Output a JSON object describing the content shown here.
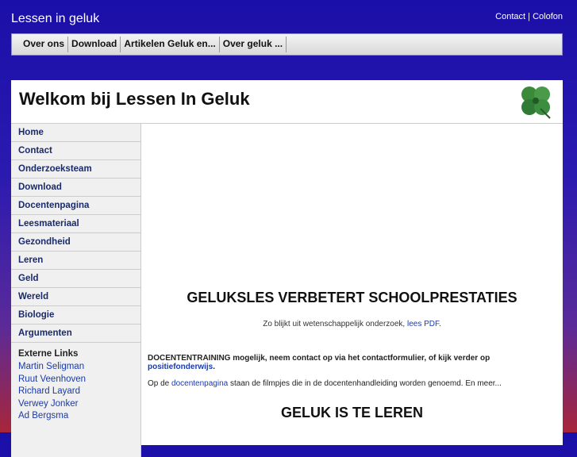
{
  "site": {
    "title": "Lessen in geluk",
    "top_links": [
      "Contact",
      "|",
      "Colofon"
    ]
  },
  "navbar": {
    "items": [
      "Over ons",
      "Download",
      "Artikelen Geluk en...",
      "Over geluk ..."
    ]
  },
  "header": {
    "title": "Welkom bij Lessen In Geluk",
    "logo_icon": "four-leaf-clover-icon"
  },
  "sidebar": {
    "items": [
      "Home",
      "Contact",
      "Onderzoeksteam",
      "Download",
      "Docentenpagina",
      "Leesmateriaal",
      "Gezondheid",
      "Leren",
      "Geld",
      "Wereld",
      "Biologie",
      "Argumenten"
    ],
    "external_title": "Externe Links",
    "external_links": [
      "Martin Seligman",
      "Ruut Veenhoven",
      "Richard Layard",
      "Verwey Jonker",
      "Ad Bergsma"
    ]
  },
  "content": {
    "heading1": "GELUKSLES VERBETERT SCHOOLPRESTATIES",
    "sub_text": "Zo blijkt uit wetenschappelijk onderzoek,",
    "sub_link": "lees PDF",
    "sub_end": ".",
    "training_text": "DOCENTENTRAINING mogelijk, neem contact op via het contactformulier, of kijk verder op",
    "training_link": "positiefonderwijs",
    "training_end": ".",
    "line_pre": "Op de",
    "line_link": "docentenpagina",
    "line_post": "staan de filmpjes die in de docentenhandleiding worden genoemd. En meer...",
    "heading2": "GELUK IS TE LEREN"
  },
  "colors": {
    "background_top": "#1a0fa8",
    "background_bottom": "#a8263a",
    "link": "#1a3aaa"
  }
}
